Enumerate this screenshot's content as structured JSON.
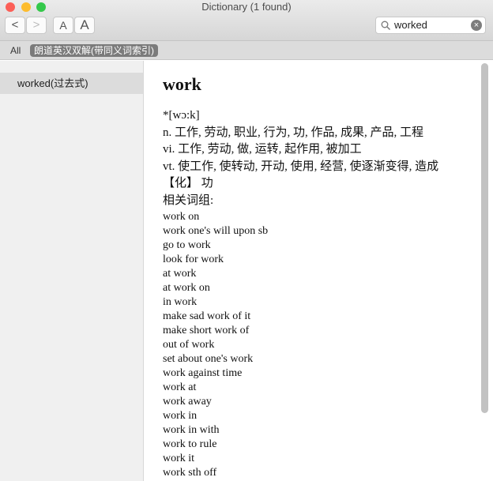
{
  "window": {
    "title": "Dictionary (1 found)"
  },
  "toolbar": {
    "back": "<",
    "forward": ">",
    "font_smaller": "A",
    "font_larger": "A",
    "search_value": "worked"
  },
  "tabs": [
    {
      "label": "All"
    },
    {
      "label": "朗道英汉双解(带同义词索引)",
      "selected": true
    }
  ],
  "sidebar": {
    "items": [
      {
        "label": "worked(过去式)",
        "selected": true
      }
    ]
  },
  "entry": {
    "headword": "work",
    "pronunciation": "*[wɔ:k]",
    "definitions": [
      "n. 工作, 劳动, 职业, 行为, 功, 作品, 成果, 产品, 工程",
      "vi. 工作, 劳动, 做, 运转, 起作用, 被加工",
      "vt. 使工作, 使转动, 开动, 使用, 经营, 使逐渐变得, 造成",
      "【化】 功"
    ],
    "phrases_label": "相关词组:",
    "phrases": [
      "work on",
      "work one's will upon sb",
      "go to work",
      "look for work",
      "at work",
      "at work on",
      "in work",
      "make sad work of it",
      "make short work of",
      "out of work",
      "set about one's work",
      "work against time",
      "work at",
      "work away",
      "work in",
      "work in with",
      "work to rule",
      "work it",
      "work sth off"
    ]
  },
  "colors": {
    "close": "#fc5f57",
    "minimize": "#fdbc2e",
    "zoom": "#34c84a",
    "selected_tab": "#7b7b7b",
    "selected_row": "#dcdcdc"
  }
}
